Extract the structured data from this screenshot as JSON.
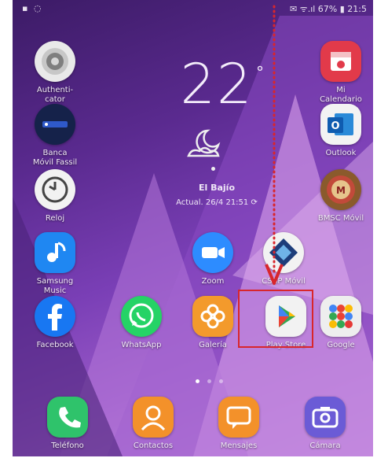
{
  "status_bar": {
    "left_icons": "▪ ◌",
    "right_text": "✉ ᯤ.ıl 67% ▮ 21:5"
  },
  "clock": {
    "time": "22",
    "degree": "°"
  },
  "weather": {
    "location": "El Bajío",
    "updated": "Actual. 26/4 21:51 ⟳"
  },
  "apps": {
    "authenticator": "Authenti-\ncator",
    "mi_calendario": "Mi\nCalendario",
    "banca_movil": "Banca\nMóvil Fassil",
    "outlook": "Outlook",
    "reloj": "Reloj",
    "bmsc": "BMSC Móvil",
    "samsung_music": "Samsung\nMusic",
    "zoom": "Zoom",
    "csbp": "CSBP Móvil",
    "facebook": "Facebook",
    "whatsapp": "WhatsApp",
    "galeria": "Galería",
    "play_store": "Play Store",
    "google": "Google"
  },
  "dock": {
    "telefono": "Teléfono",
    "contactos": "Contactos",
    "mensajes": "Mensajes",
    "camara": "Cámara"
  },
  "annotation": {
    "highlight_color": "#d8262c",
    "arrow_color": "#d8262c"
  }
}
